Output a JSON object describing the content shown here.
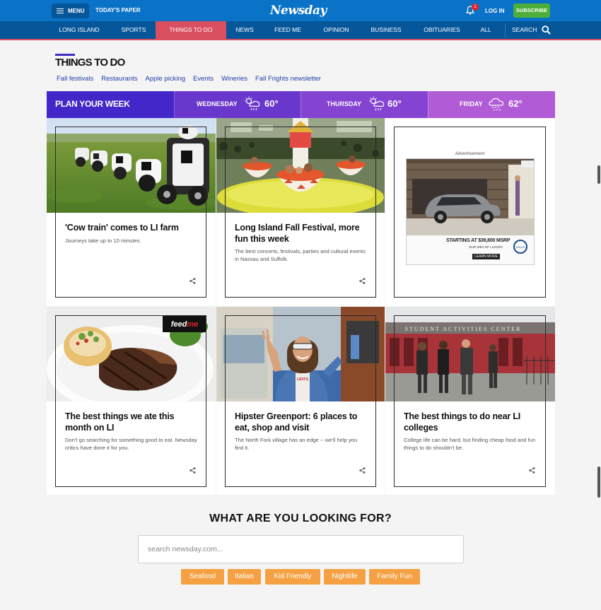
{
  "header": {
    "menu_label": "MENU",
    "todays_paper": "TODAY'S PAPER",
    "logo": "Newsday",
    "notification_count": "1",
    "login": "LOG IN",
    "subscribe": "SUBSCRIBE"
  },
  "nav": {
    "items": [
      "LONG ISLAND",
      "SPORTS",
      "THINGS TO DO",
      "NEWS",
      "FEED ME",
      "OPINION",
      "BUSINESS",
      "OBITUARIES",
      "ALL"
    ],
    "active": "THINGS TO DO",
    "search": "SEARCH"
  },
  "section": {
    "title": "THINGS TO DO",
    "links": [
      "Fall festivals",
      "Restaurants",
      "Apple picking",
      "Events",
      "Wineries",
      "Fall Frights newsletter"
    ]
  },
  "weather": {
    "heading": "PLAN YOUR WEEK",
    "days": [
      {
        "day": "WEDNESDAY",
        "temp": "60°",
        "icon": "rain-sun-icon"
      },
      {
        "day": "THURSDAY",
        "temp": "60°",
        "icon": "rain-sun-icon"
      },
      {
        "day": "FRIDAY",
        "temp": "62°",
        "icon": "rain-cloud-icon"
      }
    ]
  },
  "cards": [
    {
      "title": "'Cow train' comes to LI farm",
      "desc": "Journeys take up to 10 minutes."
    },
    {
      "title": "Long Island Fall Festival, more fun this week",
      "desc": "The best concerts, festivals, parties and cultural events in Nassau and Suffolk."
    },
    {
      "title": "The best things we ate this month on LI",
      "desc": "Don't go searching for something good to eat. Newsday critics have done it for you.",
      "badge": "feedme"
    },
    {
      "title": "Hipster Greenport: 6 places to eat, shop and visit",
      "desc": "The North Fork village has an edge -- we'll help you find it."
    },
    {
      "title": "The best things to do near LI colleges",
      "desc": "College life can be hard, but finding cheap food and fun things to do shouldn't be."
    }
  ],
  "ad": {
    "label": "Advertisement",
    "price": "STARTING AT $39,800 MSRP",
    "tagline": "OUR IDEA OF LUXURY",
    "cta": "LEARN MORE",
    "sign_text": "STUDENT ACTIVITIES CENTER",
    "shirt_text": "LEVI'S"
  },
  "search": {
    "heading": "WHAT ARE YOU LOOKING FOR?",
    "placeholder": "search newsday.com...",
    "tags": [
      "Seafood",
      "Italian",
      "Kid Friendly",
      "Nightlife",
      "Family Fun"
    ]
  },
  "colors": {
    "topbar": "#0a73c7",
    "nav": "#06569a",
    "accent": "#d94f60",
    "subscribe": "#4dae3a",
    "tag": "#f5a143"
  }
}
